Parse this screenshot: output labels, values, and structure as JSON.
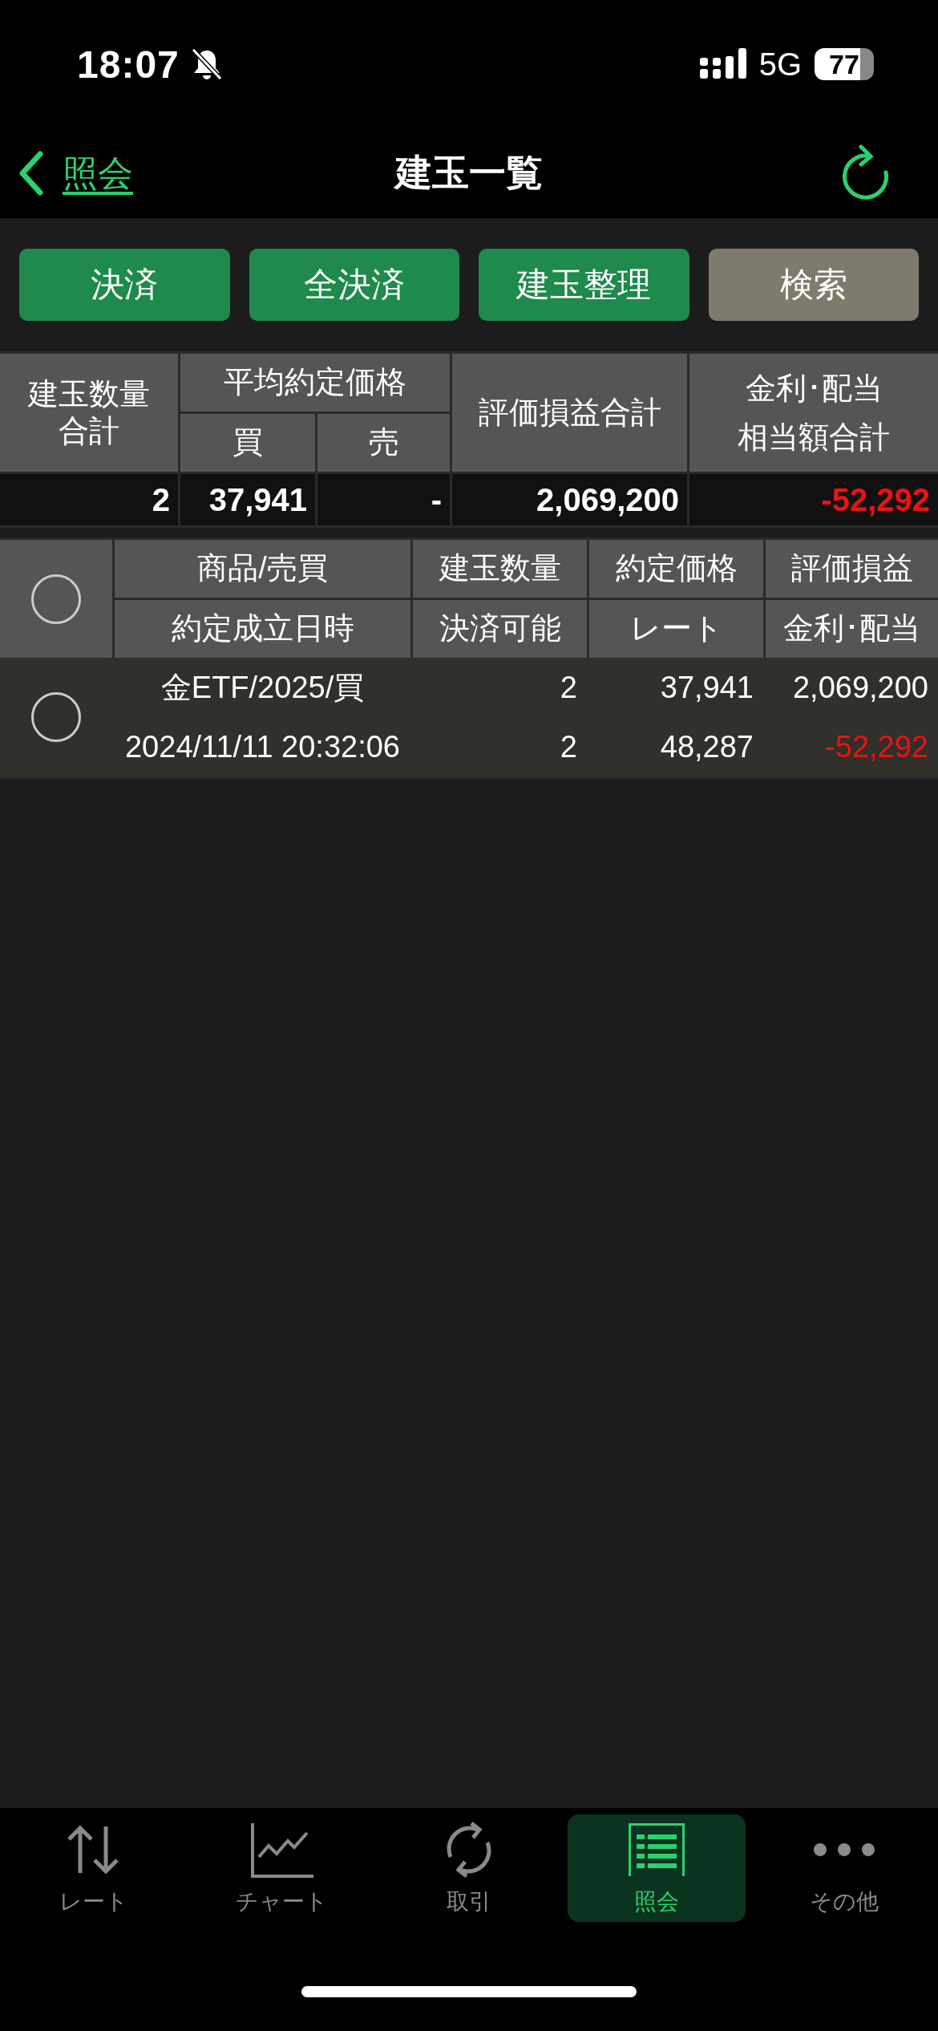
{
  "status_bar": {
    "time": "18:07",
    "network": "5G",
    "battery": "77"
  },
  "nav": {
    "back_label": "照会",
    "title": "建玉一覧"
  },
  "actions": [
    {
      "label": "決済",
      "kind": "primary"
    },
    {
      "label": "全決済",
      "kind": "primary"
    },
    {
      "label": "建玉整理",
      "kind": "primary"
    },
    {
      "label": "検索",
      "kind": "secondary"
    }
  ],
  "summary": {
    "quantity_header": [
      "建玉数量",
      "合計"
    ],
    "avg_price_header": "平均約定価格",
    "buy_header": "買",
    "sell_header": "売",
    "pl_header": "評価損益合計",
    "interest_header": [
      "金利･配当",
      "相当額合計"
    ],
    "values": [
      {
        "text": "2",
        "negative": false
      },
      {
        "text": "37,941",
        "negative": false
      },
      {
        "text": "-",
        "negative": false
      },
      {
        "text": "2,069,200",
        "negative": false
      },
      {
        "text": "-52,292",
        "negative": true
      }
    ]
  },
  "positions": {
    "select_all": {
      "selected": false
    },
    "header_top": [
      "商品/売買",
      "建玉数量",
      "約定価格",
      "評価損益"
    ],
    "header_bottom": [
      "約定成立日時",
      "決済可能",
      "レート",
      "金利･配当"
    ],
    "rows": [
      {
        "selected": false,
        "top": [
          {
            "text": "金ETF/2025/買",
            "negative": false
          },
          {
            "text": "2",
            "negative": false
          },
          {
            "text": "37,941",
            "negative": false
          },
          {
            "text": "2,069,200",
            "negative": false
          }
        ],
        "bottom": [
          {
            "text": "2024/11/11 20:32:06",
            "negative": false
          },
          {
            "text": "2",
            "negative": false
          },
          {
            "text": "48,287",
            "negative": false
          },
          {
            "text": "-52,292",
            "negative": true
          }
        ]
      }
    ]
  },
  "tab_bar": [
    {
      "label": "レート",
      "selected": false
    },
    {
      "label": "チャート",
      "selected": false
    },
    {
      "label": "取引",
      "selected": false
    },
    {
      "label": "照会",
      "selected": true
    },
    {
      "label": "その他",
      "selected": false
    }
  ]
}
